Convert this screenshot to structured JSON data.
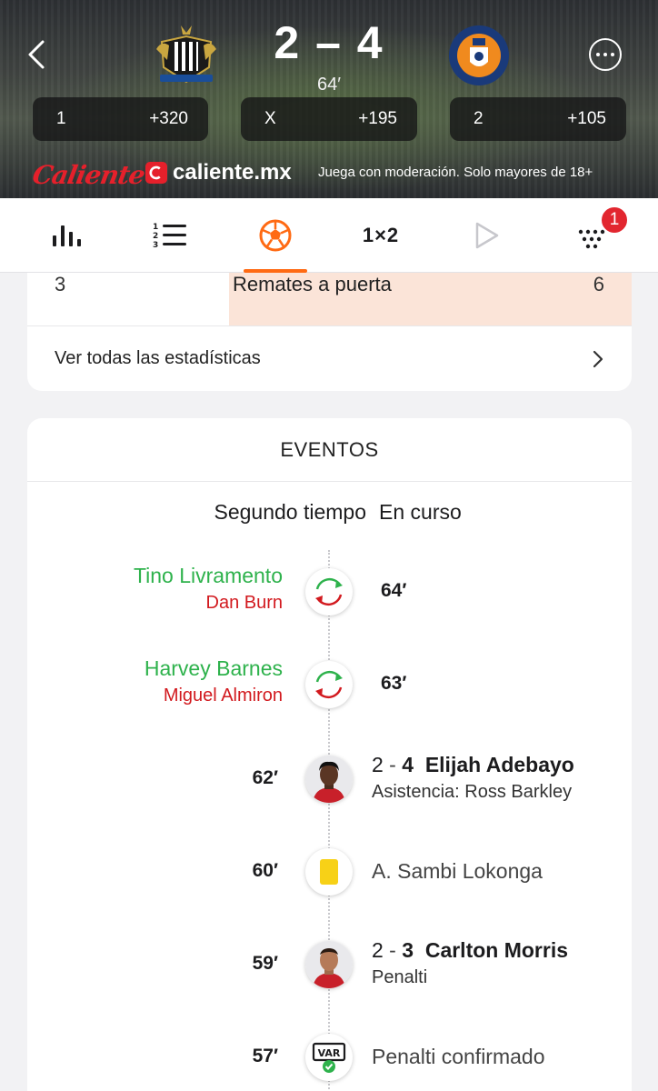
{
  "match": {
    "score": "2 – 4",
    "minute": "64′",
    "home_team": "Newcastle United",
    "away_team": "Luton Town Football Club"
  },
  "odds": [
    {
      "label": "1",
      "value": "+320"
    },
    {
      "label": "X",
      "value": "+195"
    },
    {
      "label": "2",
      "value": "+105"
    }
  ],
  "sponsor": {
    "brand": "Caliente",
    "url": "caliente.mx",
    "disclaimer": "Juega con moderación. Solo mayores de 18+"
  },
  "tabs": [
    {
      "name": "stats",
      "icon": "bar-chart-icon"
    },
    {
      "name": "lineups",
      "icon": "numbered-list-icon"
    },
    {
      "name": "events",
      "icon": "soccer-ball-icon",
      "active": true
    },
    {
      "name": "odds",
      "label": "1×2"
    },
    {
      "name": "video",
      "icon": "play-icon"
    },
    {
      "name": "more",
      "icon": "grid-dots-icon",
      "badge": "1"
    }
  ],
  "stats": {
    "row": {
      "home": "3",
      "label": "Remates a puerta",
      "away": "6"
    },
    "link_label": "Ver todas las estadísticas"
  },
  "events": {
    "title": "EVENTOS",
    "period": "Segundo tiempo",
    "status": "En curso",
    "items": [
      {
        "type": "substitution",
        "player_in": "Tino Livramento",
        "player_out": "Dan Burn",
        "minute": "64′"
      },
      {
        "type": "substitution",
        "player_in": "Harvey Barnes",
        "player_out": "Miguel Almiron",
        "minute": "63′"
      },
      {
        "type": "goal",
        "minute": "62′",
        "score_home": "2",
        "score_away": "4",
        "player": "Elijah Adebayo",
        "detail": "Asistencia: Ross Barkley"
      },
      {
        "type": "yellow-card",
        "minute": "60′",
        "player": "A. Sambi Lokonga"
      },
      {
        "type": "goal",
        "minute": "59′",
        "score_home": "2",
        "score_away": "3",
        "player": "Carlton Morris",
        "detail": "Penalti"
      },
      {
        "type": "var",
        "minute": "57′",
        "text": "Penalti confirmado"
      }
    ]
  },
  "colors": {
    "accent": "#ff6a13",
    "sub_in": "#2eb24c",
    "sub_out": "#d21a1f",
    "badge": "#e2262f",
    "highlight": "#fbe4d8",
    "yellow_card": "#f7d117"
  }
}
